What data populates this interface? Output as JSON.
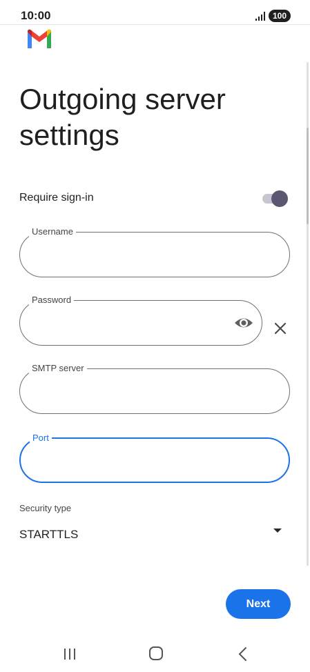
{
  "status_bar": {
    "time": "10:00",
    "battery": "100"
  },
  "app": {
    "logo": "gmail-logo",
    "title": "Outgoing server settings"
  },
  "require_signin": {
    "label": "Require sign-in",
    "enabled": true
  },
  "fields": {
    "username": {
      "label": "Username",
      "value": ""
    },
    "password": {
      "label": "Password",
      "value": ""
    },
    "smtp_server": {
      "label": "SMTP server",
      "value": ""
    },
    "port": {
      "label": "Port",
      "value": ""
    }
  },
  "security": {
    "label": "Security type",
    "value": "STARTTLS"
  },
  "actions": {
    "next_label": "Next"
  },
  "colors": {
    "accent": "#1a73e8",
    "toggle_thumb": "#5a5870",
    "toggle_track": "#c7c5d3"
  },
  "icons": {
    "password_visibility": "eye-icon",
    "clear": "close-icon",
    "dropdown": "caret-down-icon",
    "nav": [
      "recents-icon",
      "home-icon",
      "back-icon"
    ]
  }
}
